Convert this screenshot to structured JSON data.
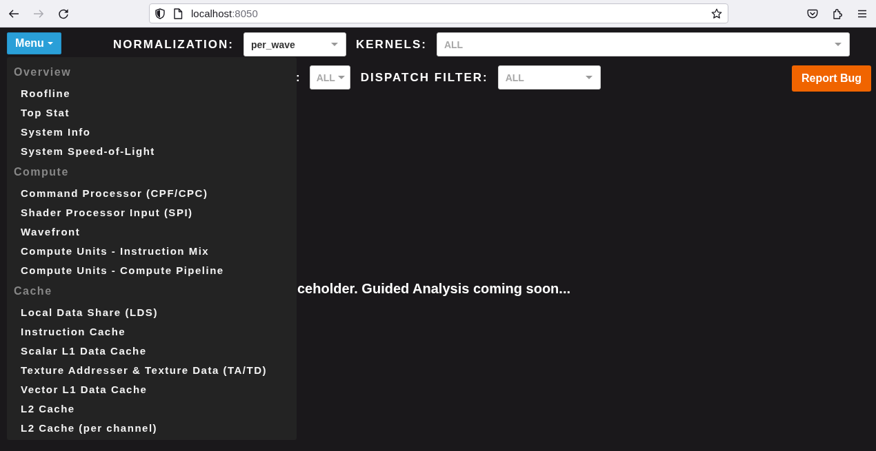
{
  "browser": {
    "nav_buttons": [
      {
        "kind": "back",
        "disabled": false
      },
      {
        "kind": "forward",
        "disabled": true
      },
      {
        "kind": "reload",
        "disabled": false
      }
    ],
    "url": {
      "host": "localhost",
      "port": ":8050"
    }
  },
  "menu": {
    "label": "Menu",
    "expanded": true,
    "sections": [
      {
        "title": "Overview",
        "items": [
          "Roofline",
          "Top Stat",
          "System Info",
          "System Speed-of-Light"
        ]
      },
      {
        "title": "Compute",
        "items": [
          "Command Processor (CPF/CPC)",
          "Shader Processor Input (SPI)",
          "Wavefront",
          "Compute Units - Instruction Mix",
          "Compute Units - Compute Pipeline"
        ]
      },
      {
        "title": "Cache",
        "items": [
          "Local Data Share (LDS)",
          "Instruction Cache",
          "Scalar L1 Data Cache",
          "Texture Addresser & Texture Data (TA/TD)",
          "Vector L1 Data Cache",
          "L2 Cache",
          "L2 Cache (per channel)"
        ]
      }
    ]
  },
  "filter_rows": [
    [
      {
        "label": "NORMALIZATION:",
        "value": "per_wave"
      },
      {
        "label": "KERNELS:",
        "placeholder": "ALL"
      }
    ],
    [
      {
        "label": ":",
        "placeholder": "ALL"
      },
      {
        "label": "DISPATCH FILTER:",
        "placeholder": "ALL"
      }
    ]
  ],
  "report_button": "Report Bug",
  "message": "ceholder. Guided Analysis coming soon..."
}
